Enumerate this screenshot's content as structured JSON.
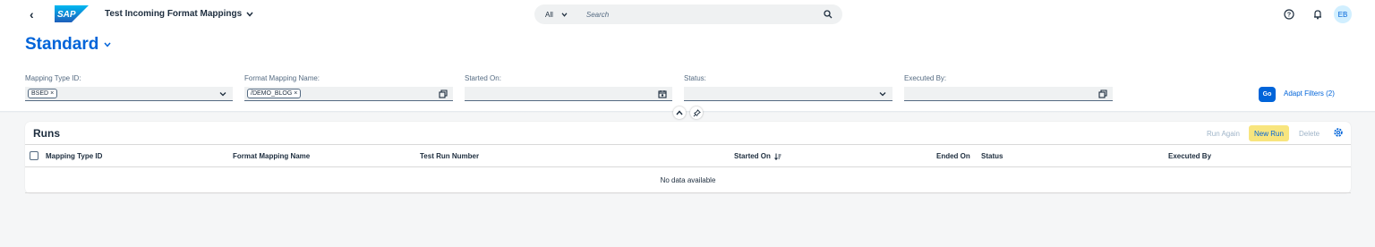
{
  "shell": {
    "app_title": "Test Incoming Format Mappings",
    "search_scope": "All",
    "search_placeholder": "Search",
    "avatar_initials": "EB",
    "logo_text": "SAP"
  },
  "header": {
    "variant_name": "Standard",
    "filters": [
      {
        "label": "Mapping Type ID:",
        "token": "BSED",
        "button_icon": "chevron-down-icon"
      },
      {
        "label": "Format Mapping Name:",
        "token": "/DEMO_BLOG",
        "button_icon": "value-help-icon"
      },
      {
        "label": "Started On:",
        "token": "",
        "button_icon": "calendar-icon"
      },
      {
        "label": "Status:",
        "token": "",
        "button_icon": "chevron-down-icon"
      },
      {
        "label": "Executed By:",
        "token": "",
        "button_icon": "value-help-icon"
      }
    ],
    "go_label": "Go",
    "adapt_filters_label": "Adapt Filters (2)"
  },
  "table": {
    "title": "Runs",
    "toolbar": {
      "run_again": "Run Again",
      "new_run": "New Run",
      "delete": "Delete"
    },
    "columns": [
      "Mapping Type ID",
      "Format Mapping Name",
      "Test Run Number",
      "Started On",
      "Ended On",
      "Status",
      "Executed By"
    ],
    "no_data": "No data available"
  },
  "colors": {
    "brand_blue": "#0064d9",
    "emphasized_button": "#f8e57e"
  }
}
